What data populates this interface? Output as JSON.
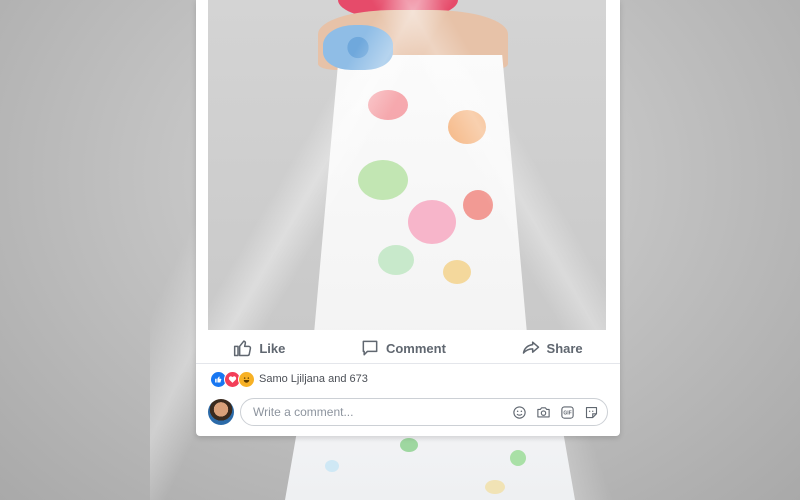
{
  "post": {
    "actions": {
      "like_label": "Like",
      "comment_label": "Comment",
      "share_label": "Share"
    },
    "reactions": {
      "summary_text": "Samo Ljiljana and 673",
      "types": [
        "like",
        "love",
        "haha"
      ]
    },
    "comment_box": {
      "placeholder": "Write a comment..."
    },
    "comment_icons": [
      "emoji-icon",
      "camera-icon",
      "gif-icon",
      "sticker-icon"
    ]
  },
  "colors": {
    "action_text": "#606770",
    "like_blue": "#1877f2",
    "love_red": "#f33e58",
    "haha_yellow": "#f7b125"
  }
}
